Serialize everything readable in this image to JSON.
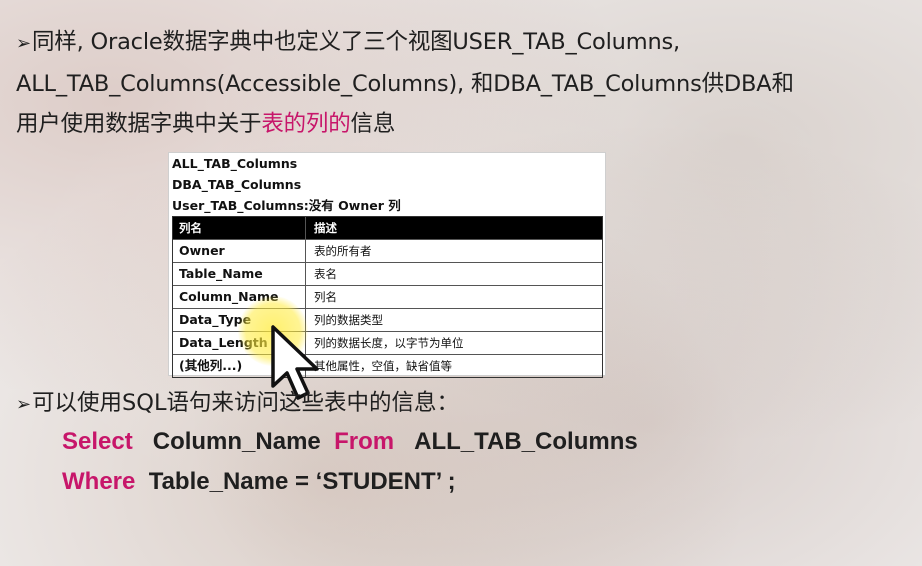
{
  "bullet_glyph": "➢",
  "paragraph": {
    "line1": "同样, Oracle数据字典中也定义了三个视图USER_TAB_Columns,",
    "line2": "ALL_TAB_Columns(Accessible_Columns), 和DBA_TAB_Columns供DBA和",
    "line3_before": "用户使用数据字典中关于",
    "line3_highlight": "表的列的",
    "line3_after": "信息"
  },
  "table_image": {
    "header_lines": [
      "ALL_TAB_Columns",
      "DBA_TAB_Columns",
      "User_TAB_Columns:没有 Owner 列"
    ],
    "columns": [
      "列名",
      "描述"
    ],
    "rows": [
      [
        "Owner",
        "表的所有者"
      ],
      [
        "Table_Name",
        "表名"
      ],
      [
        "Column_Name",
        "列名"
      ],
      [
        "Data_Type",
        "列的数据类型"
      ],
      [
        "Data_Length",
        "列的数据长度，以字节为单位"
      ],
      [
        "(其他列...)",
        "其他属性，空值，缺省值等"
      ]
    ]
  },
  "sql_intro": "可以使用SQL语句来访问这些表中的信息：",
  "sql": {
    "line1": {
      "kw1": "Select",
      "part1": "Column_Name",
      "kw2": "From",
      "part2": "ALL_TAB_Columns"
    },
    "line2": {
      "kw1": "Where",
      "part1": "Table_Name  = ‘STUDENT’ ;"
    }
  },
  "colors": {
    "accent": "#c7166a",
    "text": "#1f1f1f"
  },
  "icons": {
    "pointer": "mouse-pointer-icon"
  }
}
